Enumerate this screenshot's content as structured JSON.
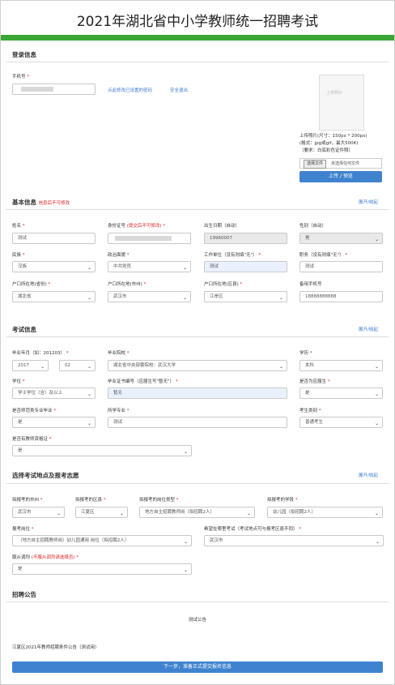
{
  "page_title": "2021年湖北省中小学教师统一招聘考试",
  "login": {
    "title": "登录信息",
    "phone_label": "手机号",
    "modify_link": "点此修改已设置的密码",
    "logout_link": "安全退出",
    "photo_placeholder": "上传照片",
    "photo_note_1": "上传照片(尺寸：150px * 200px)",
    "photo_note_2": "(格式：jpg或gif，最大500K)",
    "photo_note_3": "（要求：白底彩色证件照）",
    "choose_file": "选择文件",
    "no_file": "未选择任何文件",
    "upload_button": "上传 / 预览"
  },
  "basic": {
    "title": "基本信息",
    "warning": "信息后不可修改",
    "toggle": "展开/收起",
    "name_label": "姓名",
    "name_value": "测试",
    "idcard_label": "身份证号",
    "idcard_note": "(提交后不可修改)",
    "birth_label": "出生日期（自动）",
    "birth_value": "19960007",
    "gender_label": "性别（自动）",
    "gender_value": "男",
    "ethnic_label": "民族",
    "ethnic_value": "汉族",
    "political_label": "政治面貌",
    "political_value": "中共党员",
    "work_label": "工作单位（没有则填\"无\"）",
    "work_value": "测试",
    "position_label": "职务（没有则填\"无\"）",
    "position_value": "测试",
    "province_label": "户口所在地(省份)",
    "province_value": "湖北省",
    "city_label": "户口所在地(市州)",
    "city_value": "武汉市",
    "district_label": "户口所在地(区县)",
    "district_value": "江岸区",
    "backup_phone_label": "备用手机号",
    "backup_phone_value": "18888888888"
  },
  "exam": {
    "title": "考试信息",
    "toggle": "展开/收起",
    "grad_label": "毕业年月（如：201203）",
    "grad_year": "2017",
    "grad_month": "02",
    "school_label": "毕业院校",
    "school_value": "湖北省中央部委院校：武汉大学",
    "edu_label": "学历",
    "edu_value": "本科",
    "degree_label": "学位",
    "degree_value": "学士学位（含）及以上",
    "cert_no_label": "毕业证书编号（应届生写\"暂无\"）",
    "cert_no_value": "暂无",
    "fresh_label": "是否为应届生",
    "fresh_value": "是",
    "normal_label": "是否师范类专业毕业",
    "normal_value": "是",
    "major_label": "所学专业",
    "major_value": "测试",
    "type_label": "考生类别",
    "type_value": "普通考生",
    "teacher_cert_label": "是否有教师资格证",
    "teacher_cert_value": "是"
  },
  "choose": {
    "title": "选择考试地点及报考志愿",
    "toggle": "展开/收起",
    "city_label": "拟报考的市州",
    "city_value": "武汉市",
    "district_label": "拟报考的区县",
    "district_value": "江夏区",
    "post_type_label": "拟报考的岗位类型",
    "post_type_value": "地方自主招聘教师岗（拟招聘2人）",
    "stage_label": "拟报考的学段",
    "stage_value": "幼儿园（拟招聘2人）",
    "post_label": "报考岗位",
    "post_value": "（地方自主招聘教师岗）幼儿园通用 岗位（拟招聘2人）",
    "exam_site_label": "希望在哪里考试（考试地点可与报考区县不同）",
    "exam_site_value": "武汉市",
    "obey_label": "服从调剂",
    "obey_note": "(不服从调剂请选择否)",
    "obey_value": "是"
  },
  "notice": {
    "title": "招聘公告",
    "center_text": "测试公告",
    "footer_text": "江夏区2021年教师招聘条件公告（测试用）",
    "next_button": "下一步，准备正式提交报名信息"
  }
}
